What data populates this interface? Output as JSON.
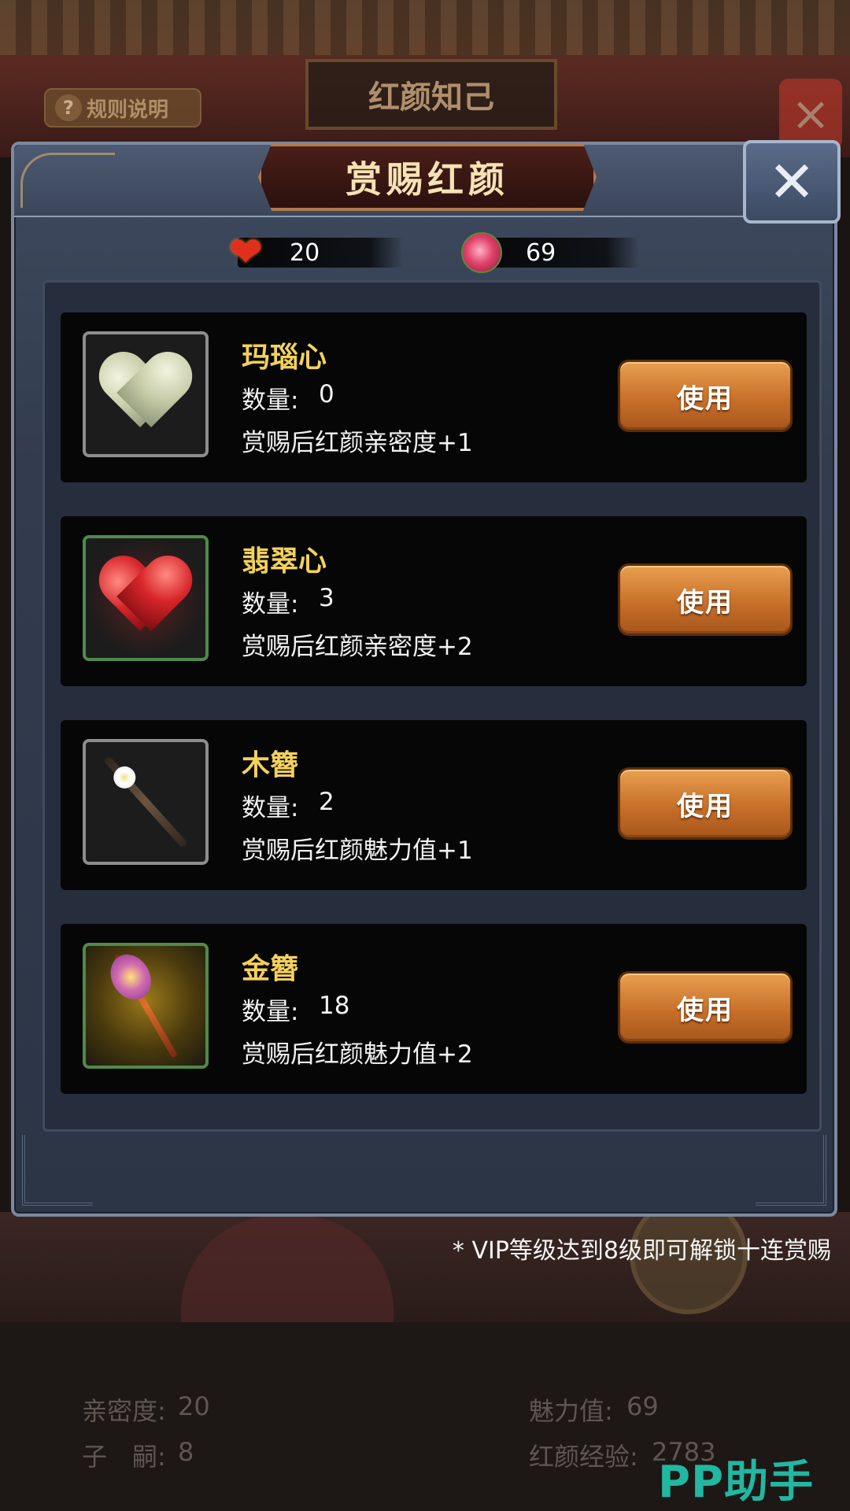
{
  "background": {
    "help_label": "规则说明",
    "screen_title": "红颜知己",
    "stats": {
      "intimacy_label": "亲密度:",
      "intimacy_value": "20",
      "charm_label": "魅力值:",
      "charm_value": "69",
      "children_label": "子　嗣:",
      "children_value": "8",
      "exp_label": "红颜经验:",
      "exp_value": "2783"
    }
  },
  "dialog": {
    "title": "赏赐红颜",
    "close_icon": "close-icon",
    "currencies": [
      {
        "icon": "heart-icon",
        "value": "20"
      },
      {
        "icon": "rose-icon",
        "value": "69"
      }
    ],
    "items": [
      {
        "name": "玛瑙心",
        "qty_label": "数量:",
        "qty": "0",
        "effect": "赏赐后红颜亲密度+1",
        "icon": "jade-heart-icon",
        "button": "使用"
      },
      {
        "name": "翡翠心",
        "qty_label": "数量:",
        "qty": "3",
        "effect": "赏赐后红颜亲密度+2",
        "icon": "red-heart-icon",
        "button": "使用"
      },
      {
        "name": "木簪",
        "qty_label": "数量:",
        "qty": "2",
        "effect": "赏赐后红颜魅力值+1",
        "icon": "wooden-hairpin-icon",
        "button": "使用"
      },
      {
        "name": "金簪",
        "qty_label": "数量:",
        "qty": "18",
        "effect": "赏赐后红颜魅力值+2",
        "icon": "gold-hairpin-icon",
        "button": "使用"
      }
    ]
  },
  "vip_note": "* VIP等级达到8级即可解锁十连赏赐",
  "watermark": "PP助手"
}
